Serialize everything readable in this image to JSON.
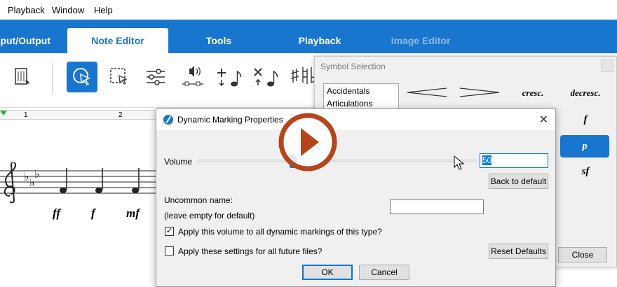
{
  "menu": {
    "items": [
      "Playback",
      "Window",
      "Help"
    ]
  },
  "tabs": [
    {
      "label": "Input/Output",
      "state": "normal"
    },
    {
      "label": "Note Editor",
      "state": "active"
    },
    {
      "label": "Tools",
      "state": "normal"
    },
    {
      "label": "Playback",
      "state": "normal"
    },
    {
      "label": "Image Editor",
      "state": "disabled"
    }
  ],
  "toolbar": {
    "icons": [
      "score-page-icon",
      "select-arrow-icon",
      "marquee-select-icon",
      "sliders-icon",
      "speaker-waveform-icon",
      "add-note-icon",
      "remove-note-icon",
      "accidental-icon"
    ]
  },
  "ruler": {
    "marks": [
      "1",
      "2"
    ]
  },
  "score": {
    "dynamics": [
      "ff",
      "f",
      "mf"
    ]
  },
  "symbol_selection": {
    "title": "Symbol Selection",
    "categories": [
      "Accidentals",
      "Articulations"
    ],
    "symbols": [
      "cresc.",
      "decresc.",
      "f",
      "p",
      "sf"
    ],
    "selected_symbol": "p",
    "close_label": "Close"
  },
  "dialog": {
    "title": "Dynamic Marking Properties",
    "volume_label": "Volume",
    "volume_value": "50",
    "back_to_default_label": "Back to default",
    "uncommon_name_label": "Uncommon name:",
    "uncommon_name_hint": "(leave empty for default)",
    "uncommon_name_value": "",
    "apply_all_label": "Apply this volume to all dynamic markings of this type?",
    "apply_all_checked": true,
    "apply_future_label": "Apply these settings for all future files?",
    "apply_future_checked": false,
    "reset_defaults_label": "Reset Defaults",
    "ok_label": "OK",
    "cancel_label": "Cancel",
    "close_glyph": "✕"
  },
  "colors": {
    "accent": "#1976cf",
    "play_overlay": "#b5451b"
  }
}
